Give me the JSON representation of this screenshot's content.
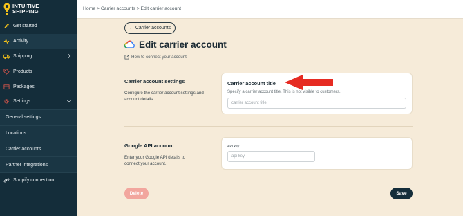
{
  "brand": {
    "line1": "INTUITIVE",
    "line2": "SHIPPING"
  },
  "sidebar": {
    "items": [
      {
        "label": "Get started",
        "icon": "rocket-icon"
      },
      {
        "label": "Activity",
        "icon": "activity-icon"
      },
      {
        "label": "Shipping",
        "icon": "truck-icon"
      },
      {
        "label": "Products",
        "icon": "tag-icon"
      },
      {
        "label": "Packages",
        "icon": "package-icon"
      },
      {
        "label": "Settings",
        "icon": "gear-icon"
      }
    ],
    "sub_items": [
      {
        "label": "General settings"
      },
      {
        "label": "Locations"
      },
      {
        "label": "Carrier accounts"
      },
      {
        "label": "Partner integrations"
      }
    ],
    "shopify": {
      "label": "Shopify connection",
      "icon": "link-icon"
    }
  },
  "breadcrumb": "Home > Carrier accounts > Edit carrier account",
  "back_button": "Carrier accounts",
  "page_title": "Edit carrier account",
  "howto_link": "How to connect your account",
  "section_settings": {
    "title": "Carrier account settings",
    "description": "Configure the carrier account settings and account details.",
    "field_label": "Carrier account title",
    "field_help": "Specify a carrier account title. This is not visible to customers.",
    "field_placeholder": "carrier account title"
  },
  "section_api": {
    "title": "Google API account",
    "description": "Enter your Google API details to connect your account.",
    "field_label": "API key",
    "field_placeholder": "api key"
  },
  "actions": {
    "delete": "Delete",
    "save": "Save"
  },
  "colors": {
    "sidebar": "#142d3a",
    "background": "#f6ebd9",
    "delete": "#f2a69e",
    "arrow": "#e62b22"
  }
}
